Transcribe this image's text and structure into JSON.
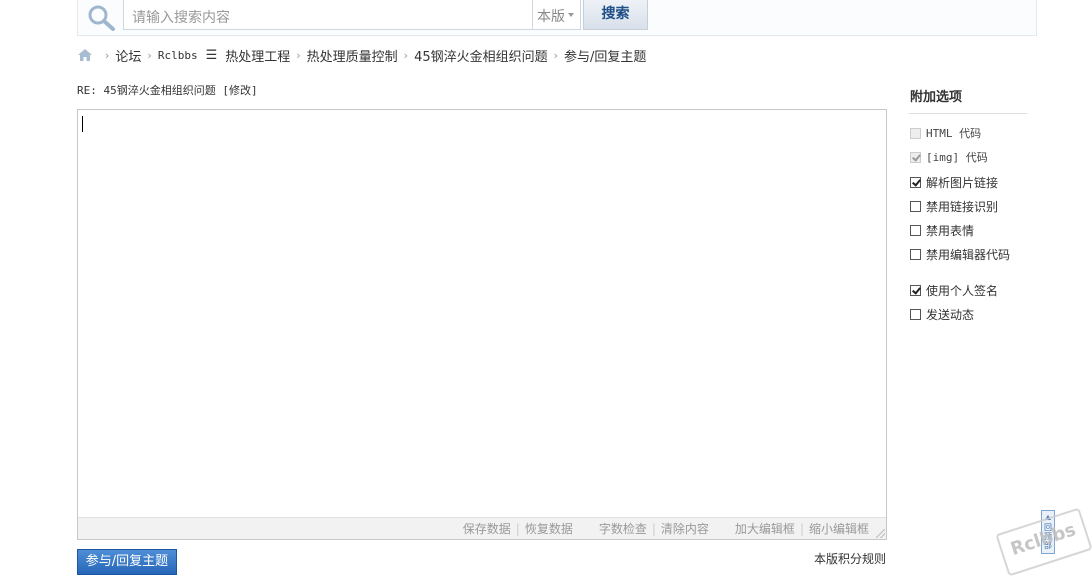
{
  "search": {
    "placeholder": "请输入搜索内容",
    "scope": "本版",
    "button_label": "搜索"
  },
  "breadcrumb": {
    "items": [
      "论坛",
      "Rclbbs",
      "热处理工程",
      "热处理质量控制",
      "45钢淬火金相组织问题",
      "参与/回复主题"
    ],
    "menu_glyph": "☰"
  },
  "reply": {
    "title": "RE: 45钢淬火金相组织问题 [修改]"
  },
  "editor": {
    "tools": [
      "保存数据",
      "恢复数据",
      "字数检查",
      "清除内容",
      "加大编辑框",
      "缩小编辑框"
    ]
  },
  "submit": {
    "label": "参与/回复主题"
  },
  "rules_link": "本版积分规则",
  "options": {
    "title": "附加选项",
    "items": [
      {
        "label": "HTML 代码",
        "checked": false,
        "disabled": true
      },
      {
        "label": "[img] 代码",
        "checked": true,
        "disabled": true
      },
      {
        "label": "解析图片链接",
        "checked": true,
        "disabled": false
      },
      {
        "label": "禁用链接识别",
        "checked": false,
        "disabled": false
      },
      {
        "label": "禁用表情",
        "checked": false,
        "disabled": false
      },
      {
        "label": "禁用编辑器代码",
        "checked": false,
        "disabled": false
      },
      {
        "label": "使用个人签名",
        "checked": true,
        "disabled": false
      },
      {
        "label": "发送动态",
        "checked": false,
        "disabled": false
      }
    ]
  },
  "back_to_top": "回顶部",
  "watermark": "Rclbbs"
}
